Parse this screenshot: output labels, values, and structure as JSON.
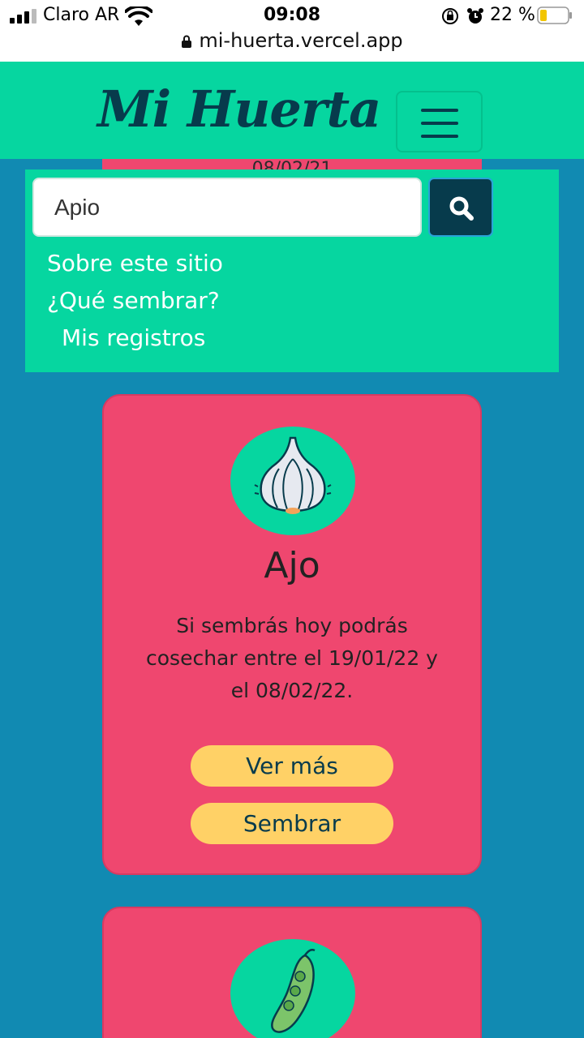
{
  "status_bar": {
    "carrier": "Claro AR",
    "time": "09:08",
    "battery_percent": "22 %",
    "url": "mi-huerta.vercel.app"
  },
  "header": {
    "brand": "Mi Huerta",
    "menu_toggle_icon": "hamburger-icon"
  },
  "behind_card": {
    "date_fragment": "08/02/21"
  },
  "menu": {
    "search_value": "Apio",
    "search_icon": "search-icon",
    "links": [
      "Sobre este sitio",
      "¿Qué sembrar?",
      "Mis registros"
    ]
  },
  "cards": [
    {
      "name": "Ajo",
      "icon": "garlic-icon",
      "description": "Si sembrás hoy podrás cosechar entre el 19/01/22 y el 08/02/22.",
      "buttons": [
        "Ver más",
        "Sembrar"
      ]
    },
    {
      "icon": "pea-pod-icon"
    }
  ],
  "colors": {
    "background": "#118ab2",
    "header": "#06d6a0",
    "card": "#ef476f",
    "button": "#ffd166",
    "dark": "#073b4c"
  }
}
